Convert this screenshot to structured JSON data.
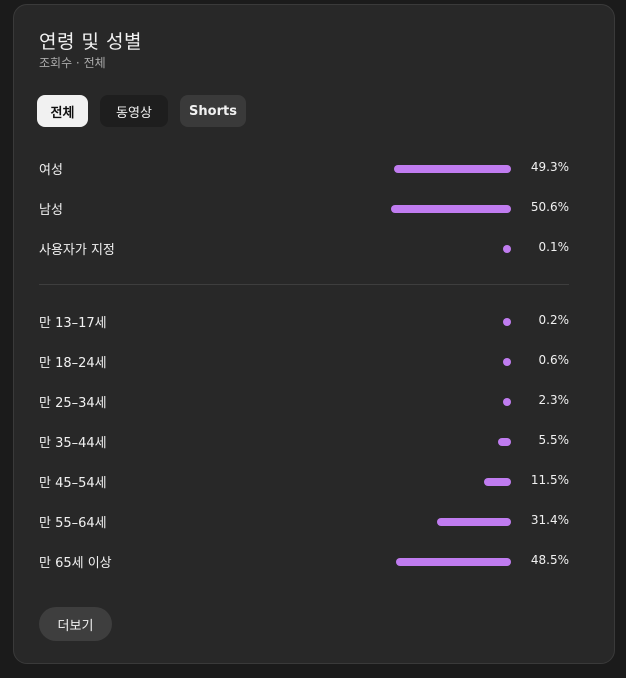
{
  "card": {
    "title": "연령 및 성별",
    "subtitle": "조회수 · 전체"
  },
  "tabs": [
    {
      "label": "전체",
      "state": "active"
    },
    {
      "label": "동영상",
      "state": "normal"
    },
    {
      "label": "Shorts",
      "state": "hover"
    }
  ],
  "gender": [
    {
      "label": "여성",
      "percent": 49.3,
      "display": "49.3%"
    },
    {
      "label": "남성",
      "percent": 50.6,
      "display": "50.6%"
    },
    {
      "label": "사용자가 지정",
      "percent": 0.1,
      "display": "0.1%"
    }
  ],
  "age": [
    {
      "label": "만 13–17세",
      "percent": 0.2,
      "display": "0.2%"
    },
    {
      "label": "만 18–24세",
      "percent": 0.6,
      "display": "0.6%"
    },
    {
      "label": "만 25–34세",
      "percent": 2.3,
      "display": "2.3%"
    },
    {
      "label": "만 35–44세",
      "percent": 5.5,
      "display": "5.5%"
    },
    {
      "label": "만 45–54세",
      "percent": 11.5,
      "display": "11.5%"
    },
    {
      "label": "만 55–64세",
      "percent": 31.4,
      "display": "31.4%"
    },
    {
      "label": "만 65세 이상",
      "percent": 48.5,
      "display": "48.5%"
    }
  ],
  "more_button": {
    "label": "더보기"
  },
  "colors": {
    "bar": "#c07cf0",
    "card_bg": "#282828",
    "page_bg": "#1b1b1b"
  }
}
